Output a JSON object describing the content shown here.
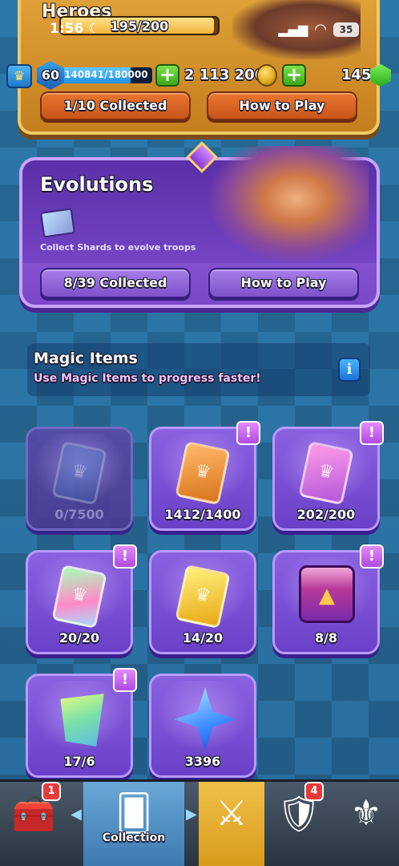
{
  "status_bar": {
    "time": "1:56",
    "battery": "35",
    "icons": [
      "moon-icon",
      "signal-icon",
      "wifi-icon"
    ]
  },
  "heroes": {
    "title": "Heroes",
    "progress_text": "195/200",
    "progress_fraction": 0.975,
    "collected": "1/10 Collected",
    "how_to_play": "How to Play"
  },
  "currency": {
    "level": "60",
    "xp_text": "140841/180000",
    "xp_fraction": 0.78,
    "gold": "2 113 206",
    "gems": "145"
  },
  "evolutions": {
    "title": "Evolutions",
    "subtitle": "Collect Shards to evolve troops",
    "collected": "8/39 Collected",
    "how_to_play": "How to Play"
  },
  "magic_items": {
    "title": "Magic Items",
    "subtitle": "Use Magic Items to progress faster!",
    "info_icon": "i"
  },
  "items": [
    {
      "name": "common-wild-card",
      "count": "0/7500",
      "alert": false,
      "dim": true
    },
    {
      "name": "rare-wild-card",
      "count": "1412/1400",
      "alert": true,
      "dim": false
    },
    {
      "name": "epic-wild-card",
      "count": "202/200",
      "alert": true,
      "dim": false
    },
    {
      "name": "legendary-wild-card",
      "count": "20/20",
      "alert": true,
      "dim": false
    },
    {
      "name": "champion-wild-card",
      "count": "14/20",
      "alert": false,
      "dim": false
    },
    {
      "name": "book-of-books",
      "count": "8/8",
      "alert": true,
      "dim": false
    },
    {
      "name": "wild-shard",
      "count": "17/6",
      "alert": true,
      "dim": false
    },
    {
      "name": "elite-wild-card",
      "count": "3396",
      "alert": false,
      "dim": false
    }
  ],
  "alert_mark": "!",
  "nav": {
    "shop_badge": "1",
    "collection_label": "Collection",
    "clan_badge": "4"
  },
  "colors": {
    "accent_purple": "#7a48c8",
    "accent_orange": "#c9561a",
    "bg_blue": "#2d78a8"
  }
}
